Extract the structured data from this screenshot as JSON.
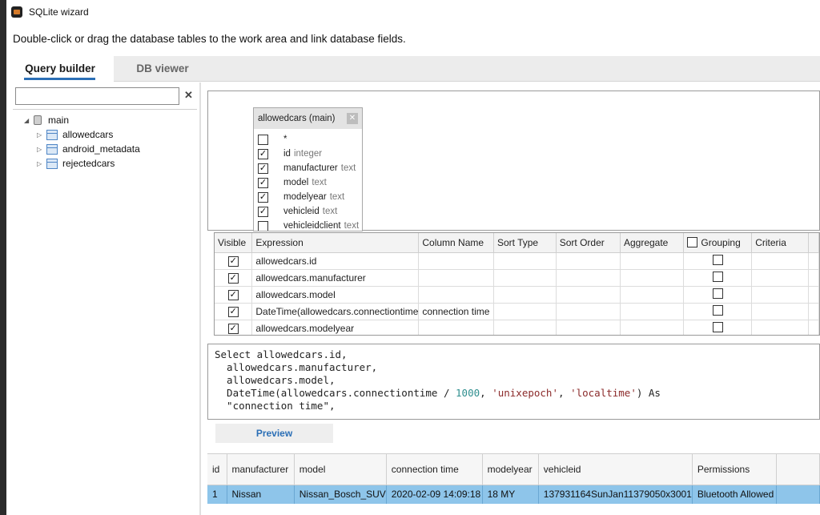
{
  "window": {
    "title": "SQLite wizard"
  },
  "instructions": "Double-click or drag the database tables to the work area and link database fields.",
  "tabs": [
    {
      "label": "Query builder",
      "active": true
    },
    {
      "label": "DB viewer",
      "active": false
    }
  ],
  "tree": {
    "search_value": "",
    "root": "main",
    "tables": [
      "allowedcars",
      "android_metadata",
      "rejectedcars"
    ]
  },
  "table_box": {
    "title": "allowedcars (main)",
    "fields": [
      {
        "name": "*",
        "type": "",
        "checked": false
      },
      {
        "name": "id",
        "type": "integer",
        "checked": true
      },
      {
        "name": "manufacturer",
        "type": "text",
        "checked": true
      },
      {
        "name": "model",
        "type": "text",
        "checked": true
      },
      {
        "name": "modelyear",
        "type": "text",
        "checked": true
      },
      {
        "name": "vehicleid",
        "type": "text",
        "checked": true
      },
      {
        "name": "vehicleidclient",
        "type": "text",
        "checked": false
      }
    ]
  },
  "grid": {
    "headers": [
      "Visible",
      "Expression",
      "Column Name",
      "Sort Type",
      "Sort Order",
      "Aggregate",
      "Grouping",
      "Criteria"
    ],
    "rows": [
      {
        "expression": "allowedcars.id",
        "column_name": ""
      },
      {
        "expression": "allowedcars.manufacturer",
        "column_name": ""
      },
      {
        "expression": "allowedcars.model",
        "column_name": ""
      },
      {
        "expression": "DateTime(allowedcars.connectiontime",
        "column_name": "connection time"
      },
      {
        "expression": "allowedcars.modelyear",
        "column_name": ""
      }
    ]
  },
  "sql": {
    "lines": [
      "Select allowedcars.id,",
      "  allowedcars.manufacturer,",
      "  allowedcars.model,",
      "  DateTime(allowedcars.connectiontime / ",
      "  \"connection time\","
    ],
    "line4_num": "1000",
    "line4_sep": ", ",
    "line4_str1": "'unixepoch'",
    "line4_str2": "'localtime'",
    "line4_tail": ") As"
  },
  "preview_label": "Preview",
  "results": {
    "headers": [
      "id",
      "manufacturer",
      "model",
      "connection time",
      "modelyear",
      "vehicleid",
      "Permissions"
    ],
    "rows": [
      [
        "1",
        "Nissan",
        "Nissan_Bosch_SUV",
        "2020-02-09 14:09:18",
        "18 MY",
        "137931164SunJan11379050x3001",
        "Bluetooth Allowed"
      ]
    ]
  }
}
